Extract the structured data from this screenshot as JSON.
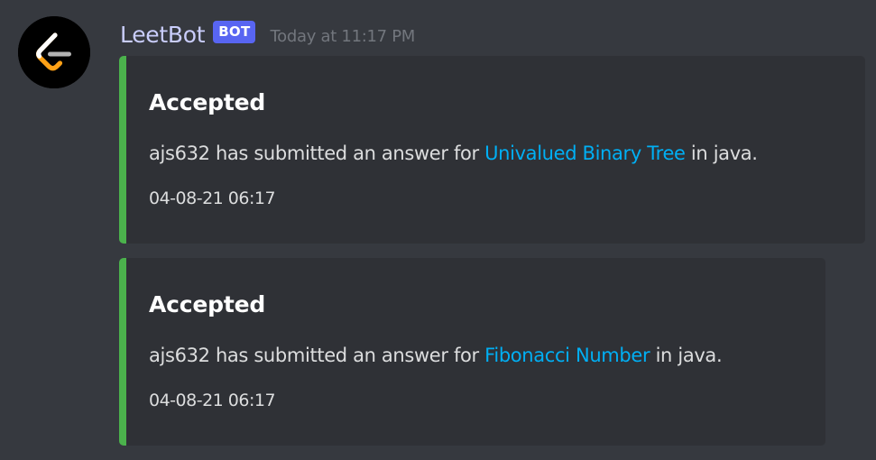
{
  "message": {
    "author": "LeetBot",
    "bot_tag": "BOT",
    "timestamp": "Today at 11:17 PM",
    "avatar_icon": "leetcode-logo-icon",
    "colors": {
      "background": "#36393f",
      "embed_background": "#2f3136",
      "embed_accent": "#4bb24c",
      "bot_tag": "#5865f2",
      "link": "#00aff4",
      "username": "#c9cdfb"
    }
  },
  "embeds": [
    {
      "title": "Accepted",
      "desc_prefix": "ajs632 has submitted an answer for ",
      "link_text": "Univalued Binary Tree",
      "desc_suffix": " in java.",
      "footer": "04-08-21 06:17"
    },
    {
      "title": "Accepted",
      "desc_prefix": "ajs632 has submitted an answer for ",
      "link_text": "Fibonacci Number",
      "desc_suffix": " in java.",
      "footer": "04-08-21 06:17"
    }
  ]
}
